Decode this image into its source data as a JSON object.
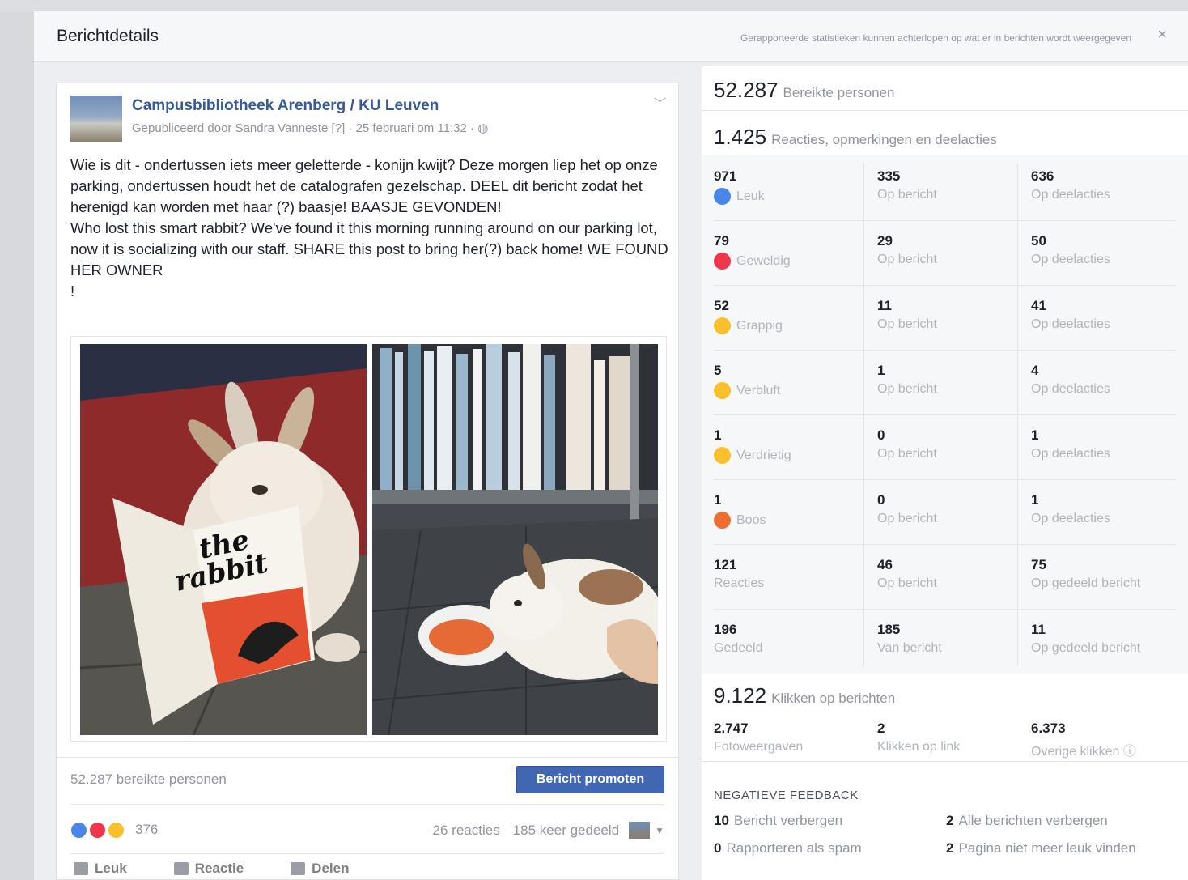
{
  "modal": {
    "title": "Berichtdetails",
    "note": "Gerapporteerde statistieken kunnen achterlopen op wat er in berichten wordt weergegeven",
    "close": "×"
  },
  "post": {
    "page_name": "Campusbibliotheek Arenberg / KU Leuven",
    "meta": "Gepubliceerd door Sandra Vanneste [?] · 25 februari om 11:32 · ◍",
    "text": "Wie is dit - ondertussen iets meer geletterde - konijn kwijt? Deze morgen liep het op onze parking, ondertussen houdt het de catalografen gezelschap. DEEL dit bericht zodat het herenigd kan worden met haar (?) baasje! BAASJE GEVONDEN!\nWho lost this smart rabbit? We've found it this morning running around on our parking lot, now it is socializing with our staff. SHARE this post to bring her(?) back home! WE FOUND HER OWNER\n!",
    "book_title_1": "the",
    "book_title_2": "rabbit",
    "reach": "52.287 bereikte personen",
    "promote": "Bericht promoten",
    "reaction_count": "376",
    "comments": "26 reacties",
    "shares": "185 keer gedeeld",
    "actions": {
      "like": "Leuk",
      "comment": "Reactie",
      "share": "Delen"
    }
  },
  "stats": {
    "reach": {
      "value": "52.287",
      "label": "Bereikte personen"
    },
    "engagement": {
      "value": "1.425",
      "label": "Reacties, opmerkingen en deelacties"
    },
    "rows": [
      [
        {
          "n": "971",
          "l": "Leuk",
          "emo": "like"
        },
        {
          "n": "335",
          "l": "Op bericht"
        },
        {
          "n": "636",
          "l": "Op deelacties"
        }
      ],
      [
        {
          "n": "79",
          "l": "Geweldig",
          "emo": "love"
        },
        {
          "n": "29",
          "l": "Op bericht"
        },
        {
          "n": "50",
          "l": "Op deelacties"
        }
      ],
      [
        {
          "n": "52",
          "l": "Grappig",
          "emo": "haha"
        },
        {
          "n": "11",
          "l": "Op bericht"
        },
        {
          "n": "41",
          "l": "Op deelacties"
        }
      ],
      [
        {
          "n": "5",
          "l": "Verbluft",
          "emo": "wow"
        },
        {
          "n": "1",
          "l": "Op bericht"
        },
        {
          "n": "4",
          "l": "Op deelacties"
        }
      ],
      [
        {
          "n": "1",
          "l": "Verdrietig",
          "emo": "sad"
        },
        {
          "n": "0",
          "l": "Op bericht"
        },
        {
          "n": "1",
          "l": "Op deelacties"
        }
      ],
      [
        {
          "n": "1",
          "l": "Boos",
          "emo": "angry"
        },
        {
          "n": "0",
          "l": "Op bericht"
        },
        {
          "n": "1",
          "l": "Op deelacties"
        }
      ],
      [
        {
          "n": "121",
          "l": "Reacties"
        },
        {
          "n": "46",
          "l": "Op bericht"
        },
        {
          "n": "75",
          "l": "Op gedeeld bericht"
        }
      ],
      [
        {
          "n": "196",
          "l": "Gedeeld"
        },
        {
          "n": "185",
          "l": "Van bericht"
        },
        {
          "n": "11",
          "l": "Op gedeeld bericht"
        }
      ]
    ],
    "clicks": {
      "value": "9.122",
      "label": "Klikken op berichten"
    },
    "click_cells": [
      {
        "n": "2.747",
        "l": "Fotoweergaven"
      },
      {
        "n": "2",
        "l": "Klikken op link"
      },
      {
        "n": "6.373",
        "l": "Overige klikken ⓘ"
      }
    ],
    "negative_title": "NEGATIEVE FEEDBACK",
    "negative": [
      {
        "n": "10",
        "l": "Bericht verbergen"
      },
      {
        "n": "2",
        "l": "Alle berichten verbergen"
      },
      {
        "n": "0",
        "l": "Rapporteren als spam"
      },
      {
        "n": "2",
        "l": "Pagina niet meer leuk vinden"
      }
    ]
  },
  "colors": {
    "like": "#4a86e8",
    "love": "#f0364b",
    "haha": "#f7c02c",
    "wow": "#f7c02c",
    "sad": "#f7c02c",
    "angry": "#ee6d32",
    "brand": "#365899",
    "button": "#4267b2"
  }
}
